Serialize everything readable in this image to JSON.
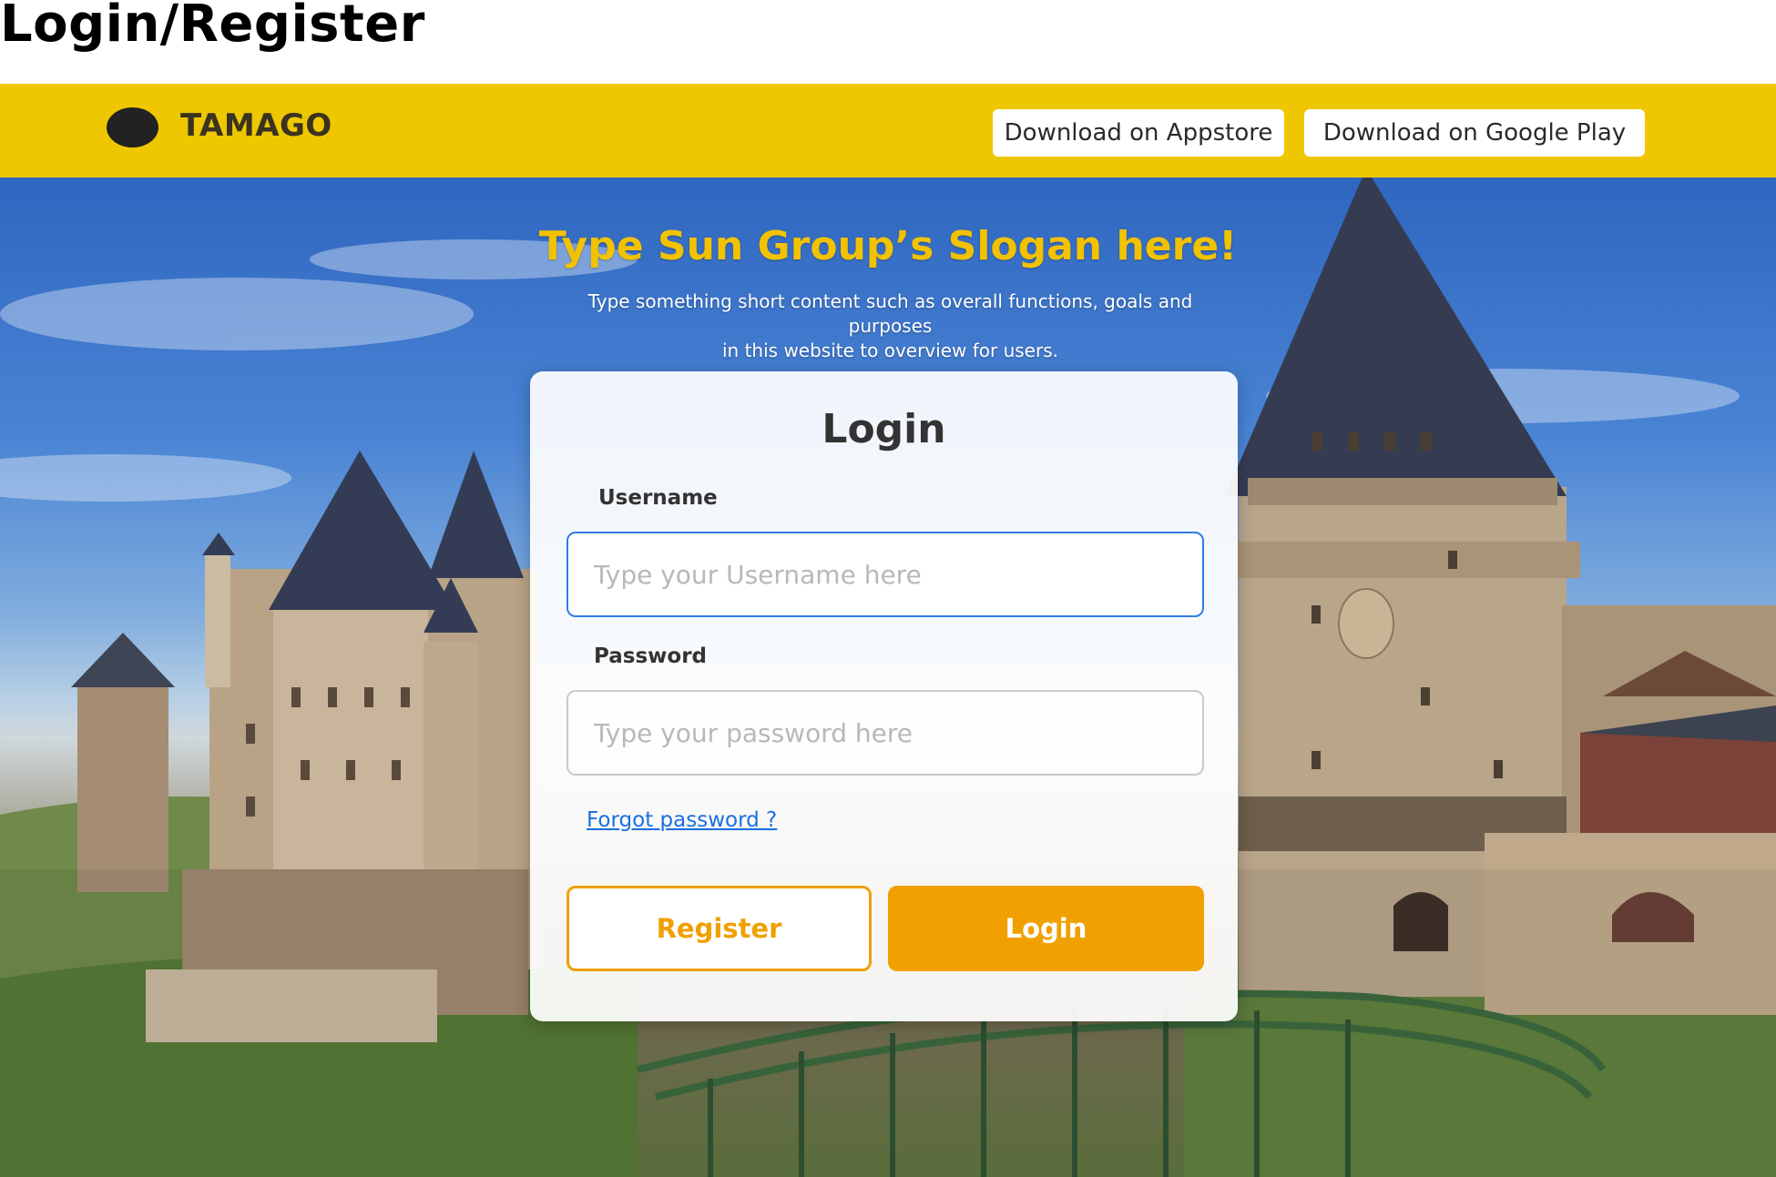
{
  "page": {
    "heading": "Login/Register"
  },
  "topbar": {
    "brand": "TAMAGO",
    "logo_icon": "logo-icon",
    "appstore_label": "Download on Appstore",
    "google_play_label": "Download on Google Play",
    "background_color": "#eec700"
  },
  "hero": {
    "slogan": "Type Sun Group’s Slogan here!",
    "subtitle_line1": "Type something short content such as overall functions, goals and purposes",
    "subtitle_line2": "in this website to overview for users."
  },
  "login_card": {
    "title": "Login",
    "username": {
      "label": "Username",
      "value": "",
      "placeholder": "Type your Username here"
    },
    "password": {
      "label": "Password",
      "value": "",
      "placeholder": "Type your password here"
    },
    "forgot_label": "Forgot password ?",
    "register_label": "Register",
    "login_label": "Login"
  },
  "colors": {
    "brand_yellow": "#eec700",
    "slogan_yellow": "#f2c200",
    "accent_orange": "#f0a000",
    "focus_blue": "#2f7de1",
    "link_blue": "#1a6fe0"
  }
}
